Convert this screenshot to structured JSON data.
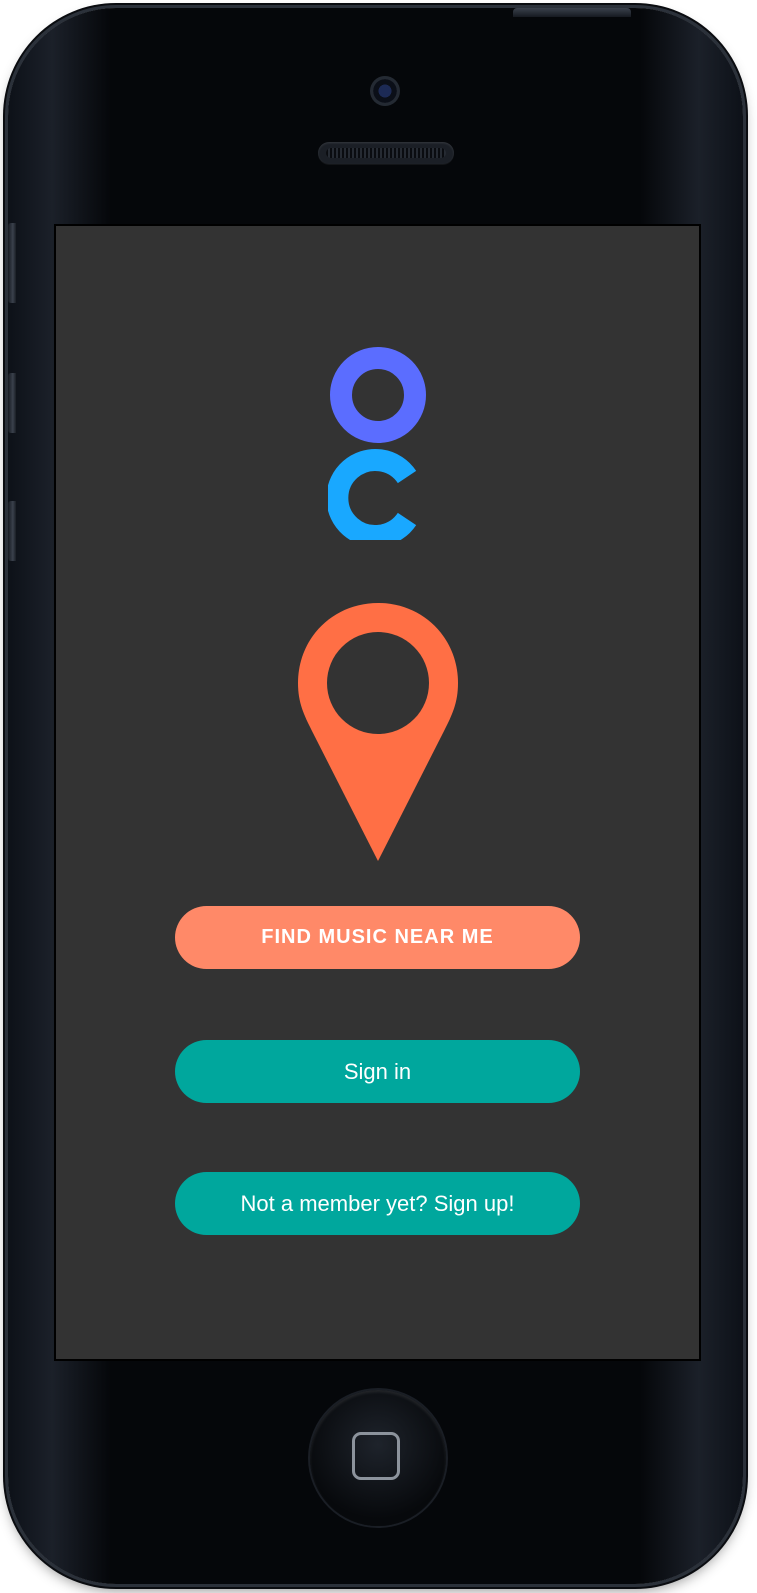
{
  "app": {
    "logo_icon": "oc-logo-icon",
    "pin_icon": "location-pin-icon"
  },
  "buttons": {
    "find_music": "FIND MUSIC NEAR ME",
    "sign_in": "Sign in",
    "sign_up": "Not a member yet? Sign up!"
  },
  "colors": {
    "screen_background": "#333333",
    "logo_top": "#5b6dff",
    "logo_bottom": "#19a8ff",
    "pin": "#ff6f45",
    "find_button": "#ff8968",
    "teal_button": "#00a79d",
    "button_text": "#ffffff"
  }
}
